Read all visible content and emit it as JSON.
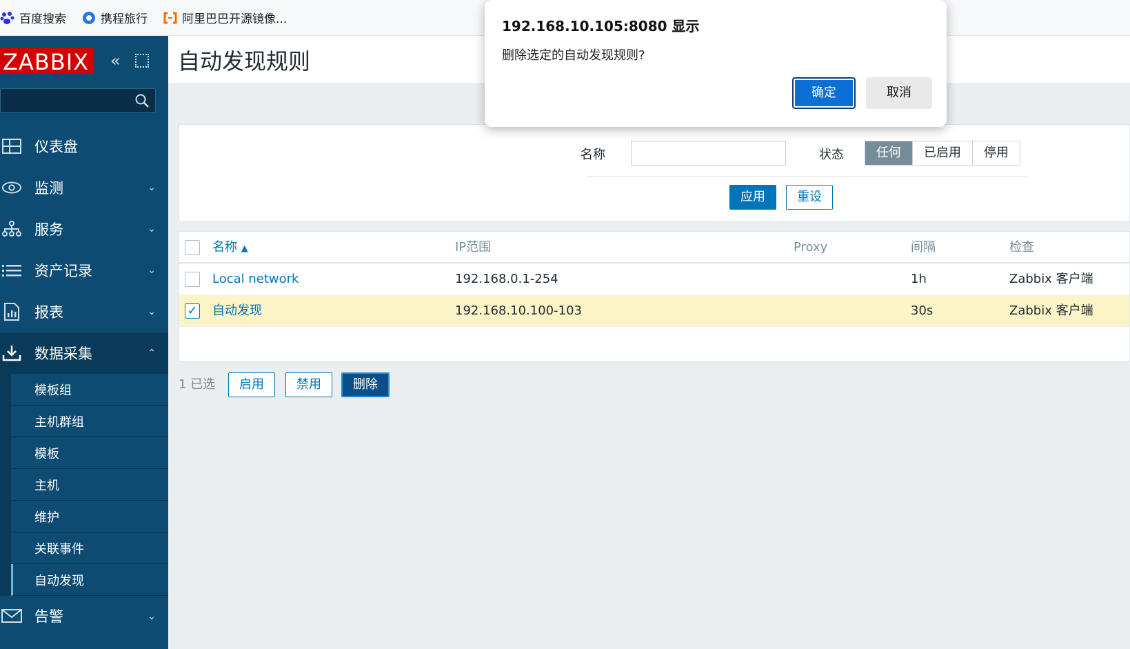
{
  "bookmarks": [
    {
      "icon": "baidu-paw-icon",
      "label": "百度搜索"
    },
    {
      "icon": "ctrip-icon",
      "label": "携程旅行"
    },
    {
      "icon": "aliyun-icon",
      "label": "阿里巴巴开源镜像..."
    }
  ],
  "sidebar": {
    "logo": "ZABBIX",
    "menu": [
      {
        "icon": "dashboard-icon",
        "label": "仪表盘"
      },
      {
        "icon": "eye-icon",
        "label": "监测"
      },
      {
        "icon": "services-icon",
        "label": "服务"
      },
      {
        "icon": "list-icon",
        "label": "资产记录"
      },
      {
        "icon": "report-icon",
        "label": "报表"
      },
      {
        "icon": "download-icon",
        "label": "数据采集"
      }
    ],
    "submenu": [
      "模板组",
      "主机群组",
      "模板",
      "主机",
      "维护",
      "关联事件",
      "自动发现"
    ],
    "alerts": {
      "icon": "envelope-icon",
      "label": "告警"
    }
  },
  "page": {
    "title": "自动发现规则"
  },
  "filter": {
    "name_label": "名称",
    "name_value": "",
    "status_label": "状态",
    "status_options": [
      "任何",
      "已启用",
      "停用"
    ],
    "status_selected": "任何",
    "apply": "应用",
    "reset": "重设"
  },
  "table": {
    "headers": {
      "name": "名称",
      "ip": "IP范围",
      "proxy": "Proxy",
      "interval": "间隔",
      "checks": "检查"
    },
    "rows": [
      {
        "checked": false,
        "name": "Local network",
        "ip": "192.168.0.1-254",
        "proxy": "",
        "interval": "1h",
        "checks": "Zabbix 客户端"
      },
      {
        "checked": true,
        "name": "自动发现",
        "ip": "192.168.10.100-103",
        "proxy": "",
        "interval": "30s",
        "checks": "Zabbix 客户端"
      }
    ]
  },
  "actions": {
    "selected": "1 已选",
    "enable": "启用",
    "disable": "禁用",
    "delete": "删除"
  },
  "dialog": {
    "title": "192.168.10.105:8080 显示",
    "message": "删除选定的自动发现规则?",
    "ok": "确定",
    "cancel": "取消"
  },
  "colors": {
    "sidebar": "#0e4b72",
    "accent": "#0275b8",
    "logo_red": "#d40000",
    "selected_row": "#fbf4c7"
  }
}
